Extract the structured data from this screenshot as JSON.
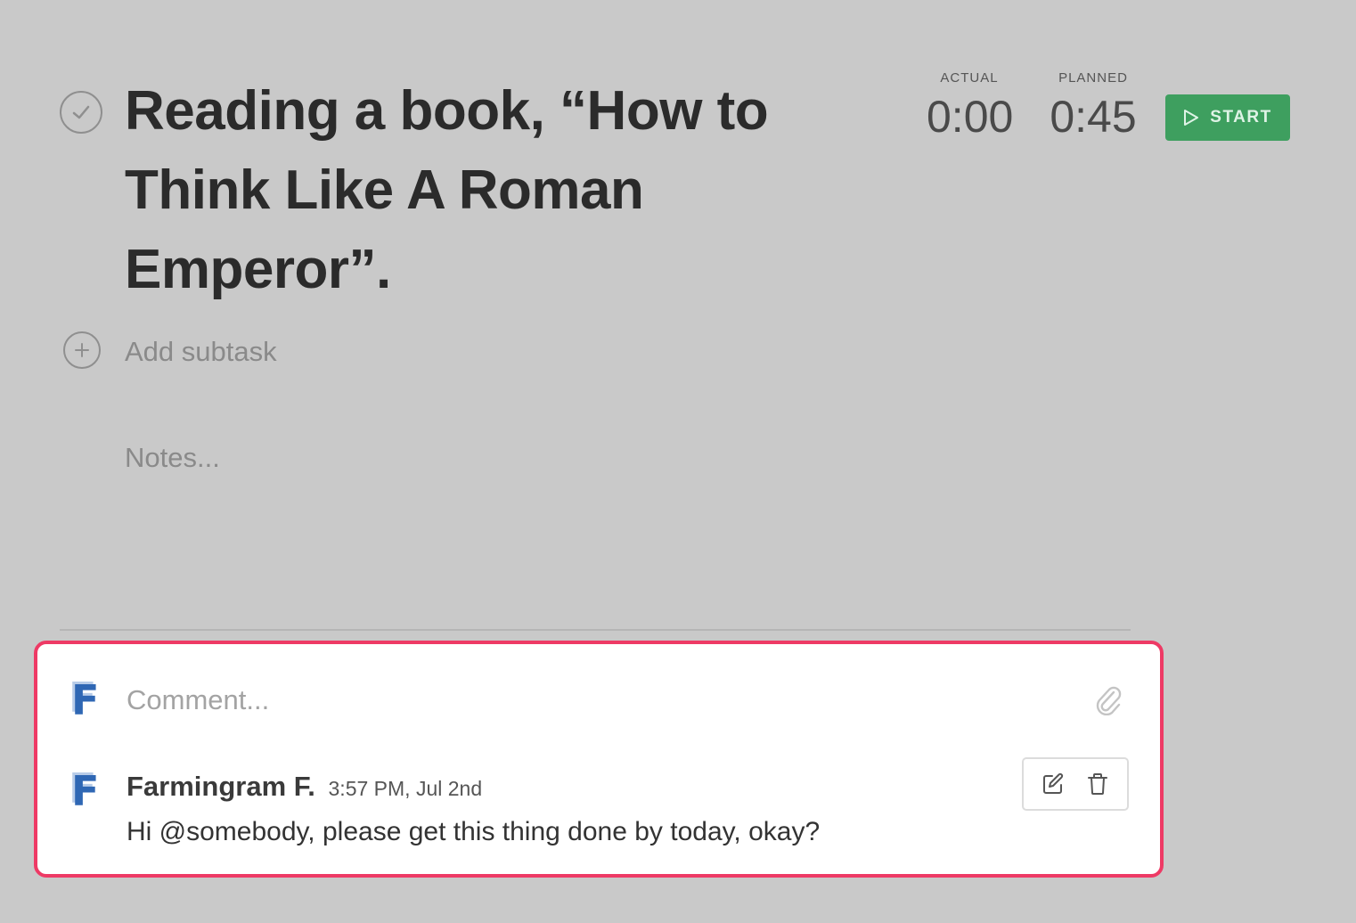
{
  "task": {
    "title": "Reading a book, “How to Think Like A Roman Emperor”.",
    "check_icon": "check-circle-icon"
  },
  "timer": {
    "actual_label": "ACTUAL",
    "actual_value": "0:00",
    "planned_label": "PLANNED",
    "planned_value": "0:45",
    "start_label": "START",
    "start_icon": "play-icon",
    "start_color": "#3e9f5f"
  },
  "subtask": {
    "add_label": "Add subtask",
    "icon": "plus-circle-icon"
  },
  "notes": {
    "placeholder": "Notes..."
  },
  "comments": {
    "highlight_color": "#ee3a65",
    "composer": {
      "avatar_letter": "F",
      "placeholder": "Comment...",
      "attach_icon": "paperclip-icon"
    },
    "items": [
      {
        "avatar_letter": "F",
        "author": "Farmingram F.",
        "time": "3:57 PM, Jul 2nd",
        "text": "Hi @somebody, please get this thing done by today, okay?",
        "actions": [
          "edit-icon",
          "trash-icon"
        ]
      }
    ]
  }
}
